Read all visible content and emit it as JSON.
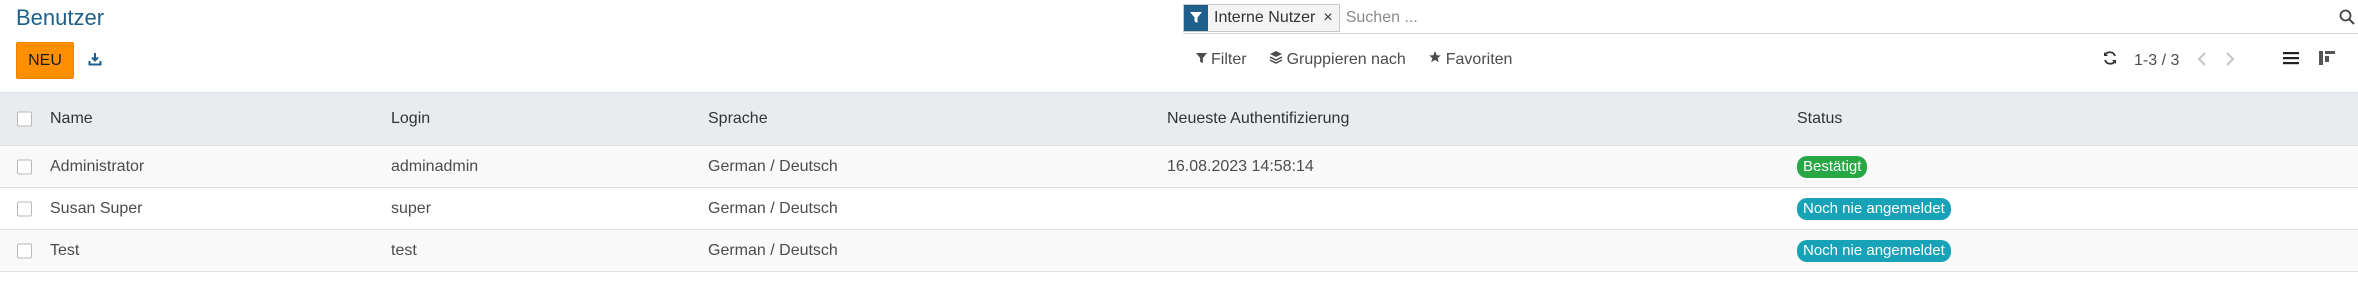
{
  "header": {
    "title": "Benutzer"
  },
  "toolbar": {
    "new_label": "NEU"
  },
  "search": {
    "facet_label": "Interne Nutzer",
    "facet_remove": "×",
    "placeholder": "Suchen ..."
  },
  "options": {
    "filter": "Filter",
    "group": "Gruppieren nach",
    "favorites": "Favoriten"
  },
  "pager": {
    "value": "1-3 / 3"
  },
  "colors": {
    "brand": "#1f5f8b",
    "primary_button": "#fe8f00",
    "badge_success": "#28a745",
    "badge_info": "#17a2b8"
  },
  "table": {
    "headers": {
      "name": "Name",
      "login": "Login",
      "language": "Sprache",
      "last_auth": "Neueste Authentifizierung",
      "status": "Status"
    },
    "rows": [
      {
        "name": "Administrator",
        "login": "adminadmin",
        "language": "German / Deutsch",
        "last_auth": "16.08.2023 14:58:14",
        "status": "Bestätigt"
      },
      {
        "name": "Susan Super",
        "login": "super",
        "language": "German / Deutsch",
        "last_auth": "",
        "status": "Noch nie angemeldet"
      },
      {
        "name": "Test",
        "login": "test",
        "language": "German / Deutsch",
        "last_auth": "",
        "status": "Noch nie angemeldet"
      }
    ]
  }
}
